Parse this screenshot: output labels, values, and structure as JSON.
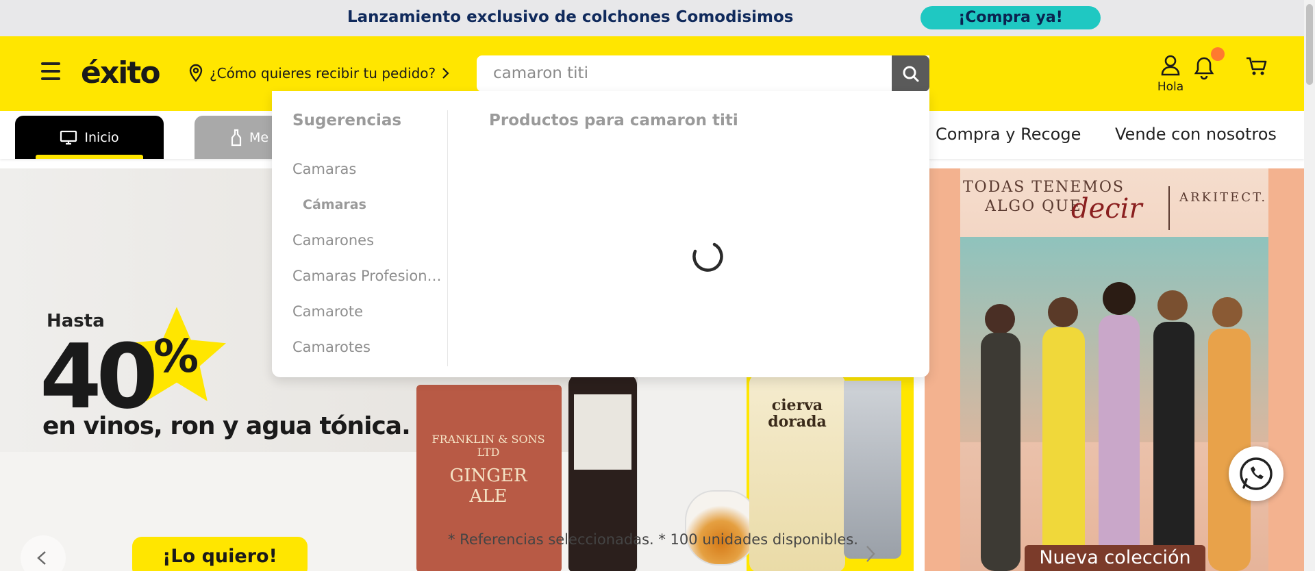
{
  "promo": {
    "text": "Lanzamiento exclusivo de colchones Comodisimos",
    "button": "¡Compra ya!"
  },
  "header": {
    "logo": "éxito",
    "delivery_prompt": "¿Cómo quieres recibir tu pedido?",
    "search": {
      "value": "camaron titi",
      "placeholder": ""
    },
    "user_label": "Hola",
    "brand_color": "#ffe600"
  },
  "categories": {
    "tabs": [
      {
        "label": "Inicio",
        "icon": "monitor-icon"
      },
      {
        "label": "Me",
        "icon": "bottle-icon"
      }
    ],
    "links": [
      "Compra y Recoge",
      "Vende con nosotros"
    ]
  },
  "search_dropdown": {
    "suggestions_title": "Sugerencias",
    "suggestions": [
      {
        "label": "Camaras",
        "sub": false
      },
      {
        "label": "Cámaras",
        "sub": true
      },
      {
        "label": "Camarones",
        "sub": false
      },
      {
        "label": "Camaras Profesionales",
        "sub": false
      },
      {
        "label": "Camarote",
        "sub": false
      },
      {
        "label": "Camarotes",
        "sub": false
      }
    ],
    "products_title": "Productos para camaron titi",
    "loading": true
  },
  "hero": {
    "hasta": "Hasta",
    "amount": "40",
    "percent": "%",
    "subtitle": "en vinos, ron y agua tónica.",
    "cta": "¡Lo quiero!",
    "disclaimer": "* Referencias seleccionadas. * 100 unidades disponibles.",
    "box_label_1": "FRANKLIN & SONS LTD",
    "box_label_2": "GINGER ALE",
    "cierva_label": "cierva dorada"
  },
  "side_banner": {
    "line1": "TODAS TENEMOS",
    "line2": "ALGO QUE",
    "accent": "decir",
    "brand": "ARKITECT.",
    "cta": "Nueva colección"
  }
}
